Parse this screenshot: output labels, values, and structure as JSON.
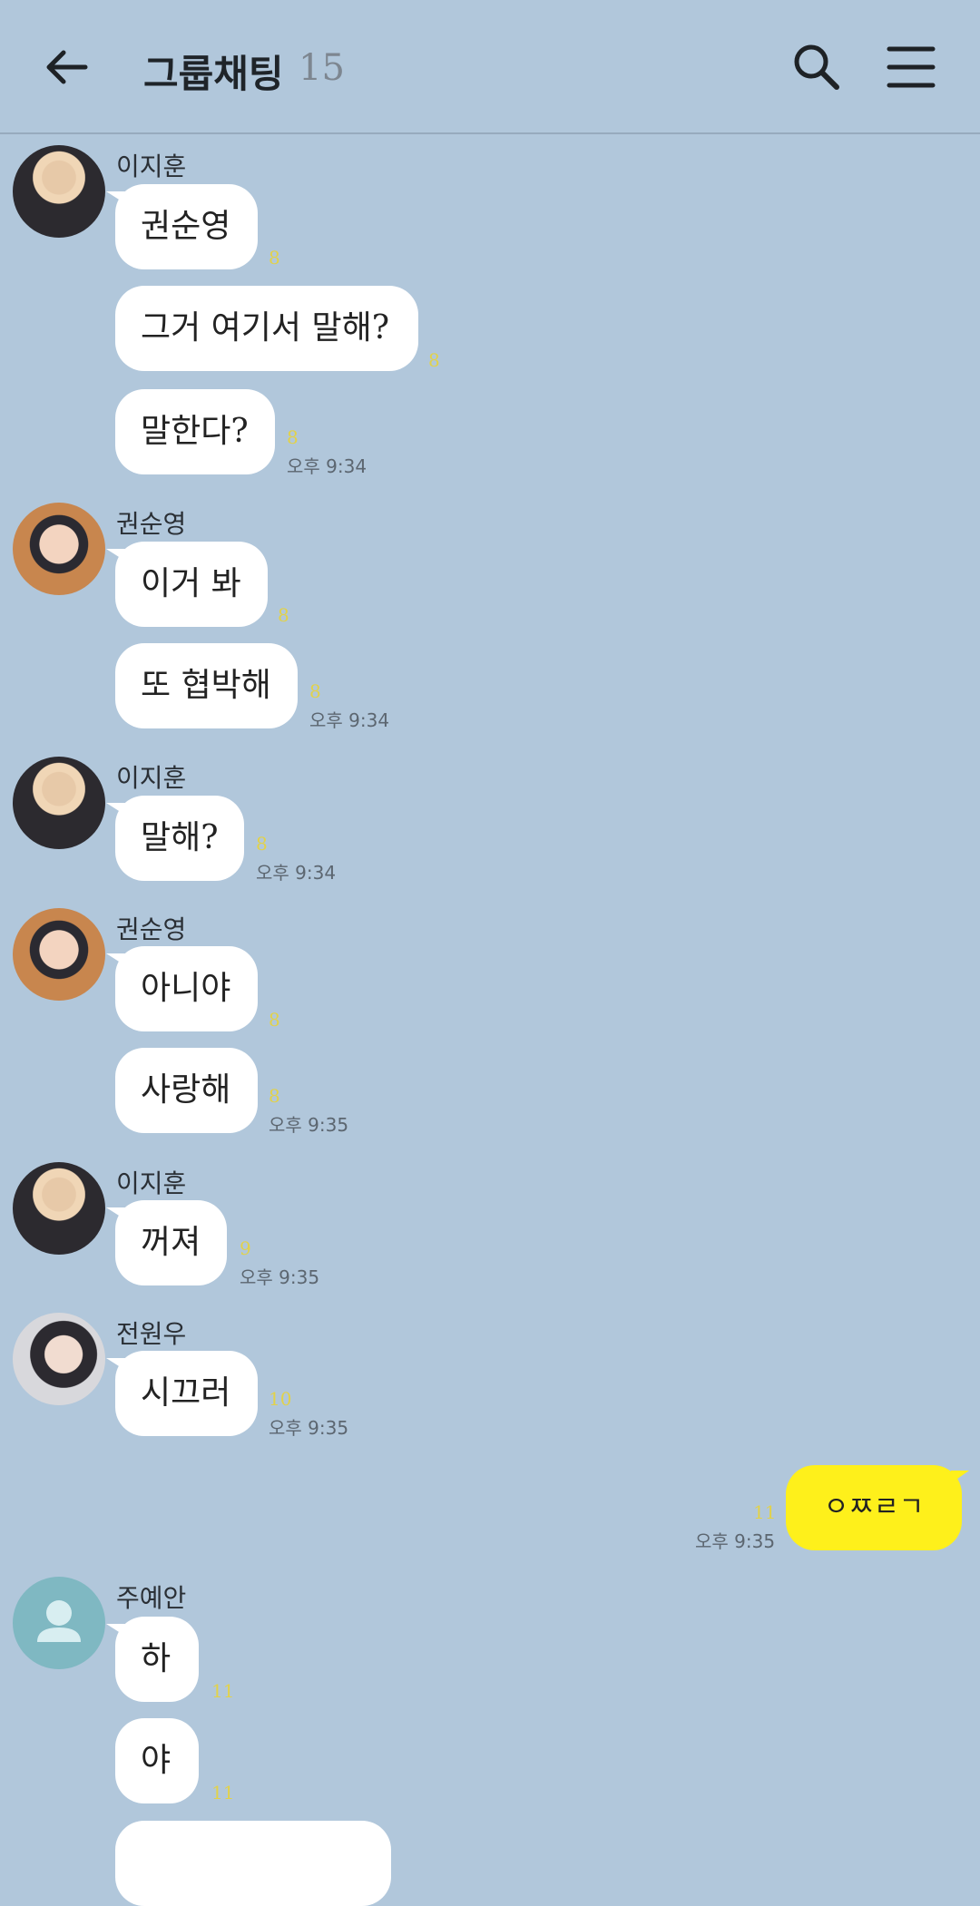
{
  "header": {
    "title": "그룹채팅",
    "member_count": "15",
    "back_icon": "back-arrow-icon",
    "search_icon": "search-icon",
    "menu_icon": "menu-icon"
  },
  "messages": {
    "jihoon1": {
      "sender": "이지훈",
      "m1": {
        "text": "권순영",
        "unread": "8"
      },
      "m2": {
        "text": "그거 여기서 말해?",
        "unread": "8"
      },
      "m3": {
        "text": "말한다?",
        "unread": "8",
        "time": "오후 9:34"
      }
    },
    "soonyoung1": {
      "sender": "권순영",
      "m1": {
        "text": "이거 봐",
        "unread": "8"
      },
      "m2": {
        "text": "또 협박해",
        "unread": "8",
        "time": "오후 9:34"
      }
    },
    "jihoon2": {
      "sender": "이지훈",
      "m1": {
        "text": "말해?",
        "unread": "8",
        "time": "오후 9:34"
      }
    },
    "soonyoung2": {
      "sender": "권순영",
      "m1": {
        "text": "아니야",
        "unread": "8"
      },
      "m2": {
        "text": "사랑해",
        "unread": "8",
        "time": "오후 9:35"
      }
    },
    "jihoon3": {
      "sender": "이지훈",
      "m1": {
        "text": "꺼져",
        "unread": "9",
        "time": "오후 9:35"
      }
    },
    "wonwoo": {
      "sender": "전원우",
      "m1": {
        "text": "시끄러",
        "unread": "10",
        "time": "오후 9:35"
      }
    },
    "mine": {
      "text": "ㅇㅉㄹㄱ",
      "unread": "11",
      "time": "오후 9:35"
    },
    "yean": {
      "sender": "주예안",
      "m1": {
        "text": "하",
        "unread": "11"
      },
      "m2": {
        "text": "야",
        "unread": "11"
      }
    }
  },
  "colors": {
    "background": "#b1c7db",
    "my_bubble": "#fef01b",
    "bubble": "#ffffff",
    "unread": "#e2d24a"
  }
}
